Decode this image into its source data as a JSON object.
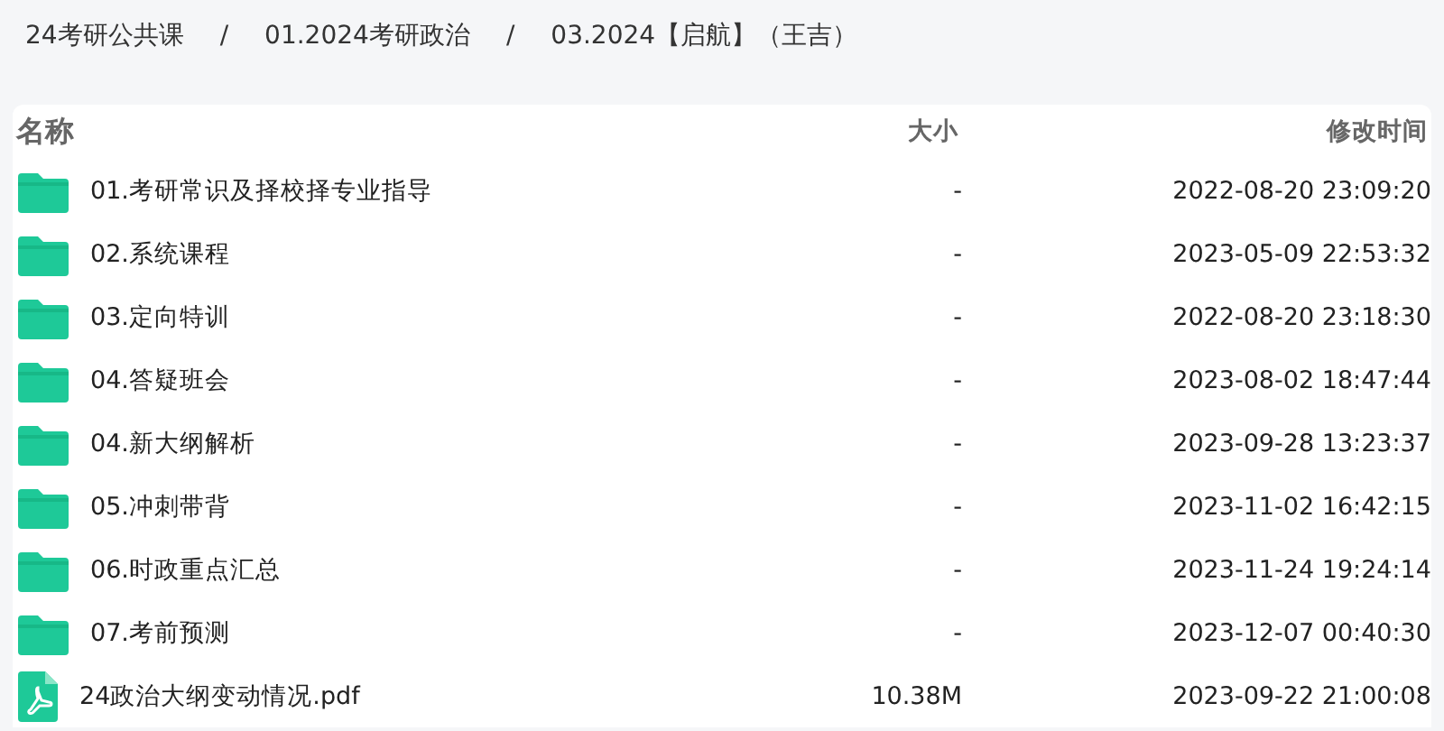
{
  "breadcrumb": [
    {
      "label": "24考研公共课"
    },
    {
      "label": "01.2024考研政治"
    },
    {
      "label": "03.2024【启航】（王吉）"
    }
  ],
  "breadcrumb_separator": "/",
  "table": {
    "columns": [
      "名称",
      "大小",
      "修改时间"
    ],
    "rows": [
      {
        "kind": "folder",
        "name": "01.考研常识及择校择专业指导",
        "size": "-",
        "modified": "2022-08-20 23:09:20"
      },
      {
        "kind": "folder",
        "name": "02.系统课程",
        "size": "-",
        "modified": "2023-05-09 22:53:32"
      },
      {
        "kind": "folder",
        "name": "03.定向特训",
        "size": "-",
        "modified": "2022-08-20 23:18:30"
      },
      {
        "kind": "folder",
        "name": "04.答疑班会",
        "size": "-",
        "modified": "2023-08-02 18:47:44"
      },
      {
        "kind": "folder",
        "name": "04.新大纲解析",
        "size": "-",
        "modified": "2023-09-28 13:23:37"
      },
      {
        "kind": "folder",
        "name": "05.冲刺带背",
        "size": "-",
        "modified": "2023-11-02 16:42:15"
      },
      {
        "kind": "folder",
        "name": "06.时政重点汇总",
        "size": "-",
        "modified": "2023-11-24 19:24:14"
      },
      {
        "kind": "folder",
        "name": "07.考前预测",
        "size": "-",
        "modified": "2023-12-07 00:40:30"
      },
      {
        "kind": "pdf",
        "name": "24政治大纲变动情况.pdf",
        "size": "10.38M",
        "modified": "2023-09-22 21:00:08"
      }
    ]
  }
}
